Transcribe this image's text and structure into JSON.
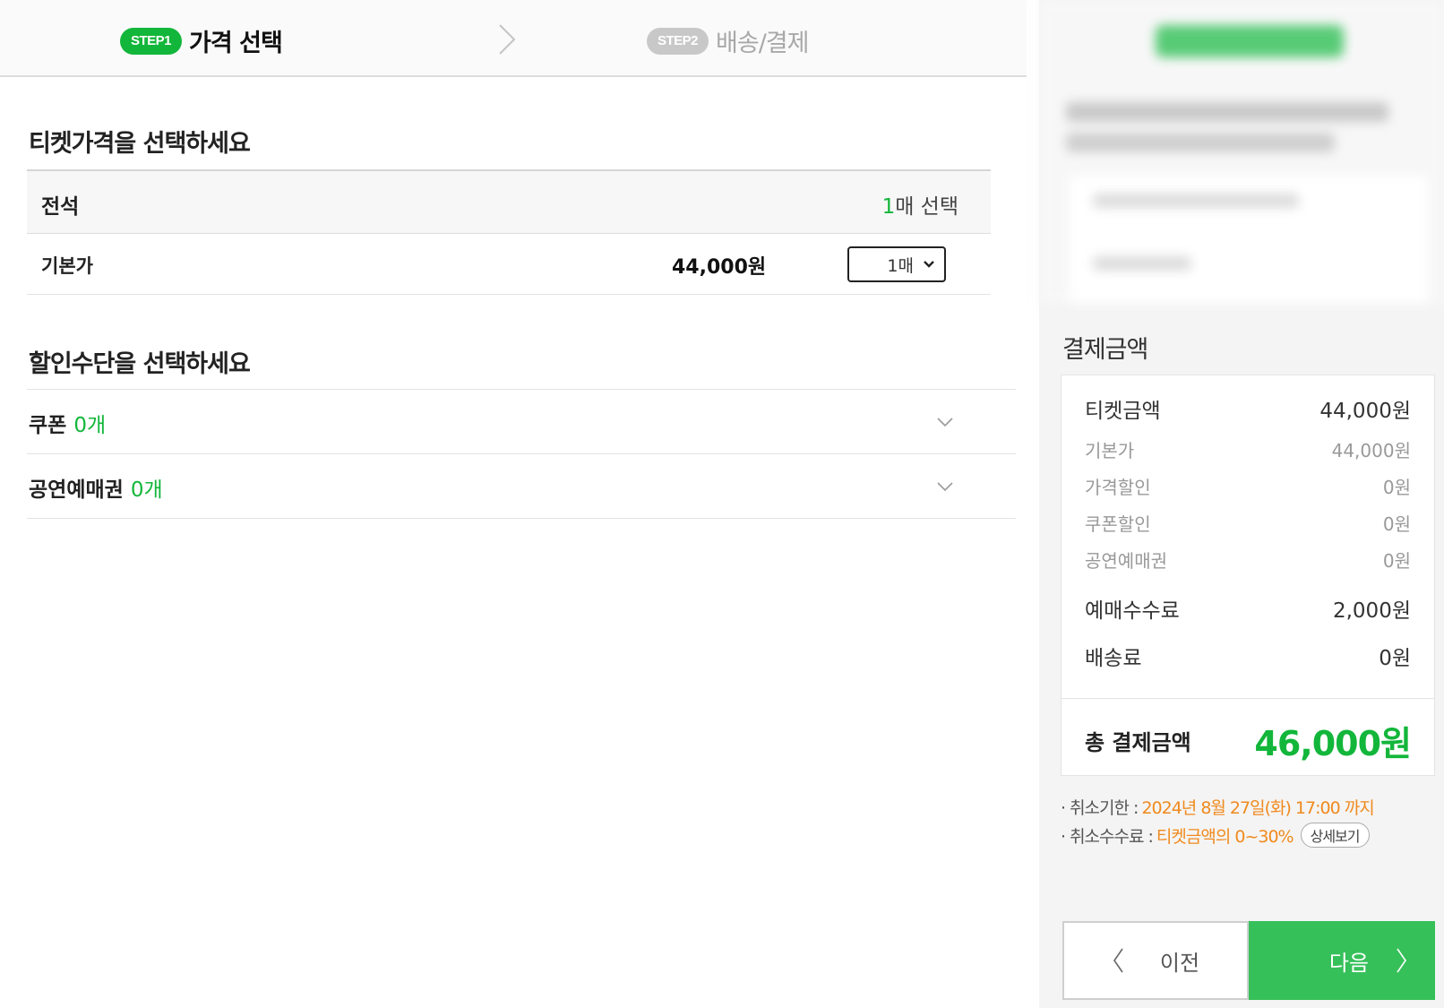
{
  "header": {
    "step1": {
      "badge": "STEP1",
      "label": "가격 선택"
    },
    "step2": {
      "badge": "STEP2",
      "label": "배송/결제"
    }
  },
  "price_section": {
    "title": "티켓가격을 선택하세요",
    "grade": {
      "name": "전석",
      "count_num": "1",
      "count_text": "매 선택"
    },
    "rows": [
      {
        "name": "기본가",
        "amount": "44,000원",
        "qty": "1매"
      }
    ]
  },
  "discount_section": {
    "title": "할인수단을 선택하세요",
    "items": [
      {
        "label": "쿠폰",
        "count": "0개"
      },
      {
        "label": "공연예매권",
        "count": "0개"
      }
    ]
  },
  "payment": {
    "title": "결제금액",
    "rows": {
      "ticket": {
        "label": "티켓금액",
        "value": "44,000원"
      },
      "base": {
        "label": "기본가",
        "value": "44,000원"
      },
      "price_dc": {
        "label": "가격할인",
        "value": "0원"
      },
      "coupon_dc": {
        "label": "쿠폰할인",
        "value": "0원"
      },
      "voucher": {
        "label": "공연예매권",
        "value": "0원"
      },
      "fee": {
        "label": "예매수수료",
        "value": "2,000원"
      },
      "shipping": {
        "label": "배송료",
        "value": "0원"
      }
    },
    "total": {
      "label": "총 결제금액",
      "value": "46,000원"
    }
  },
  "notes": {
    "cancel_deadline": {
      "label": "· 취소기한 :",
      "value": "2024년 8월 27일(화) 17:00 까지"
    },
    "cancel_fee": {
      "label": "· 취소수수료 :",
      "value": "티켓금액의 0~30%",
      "button": "상세보기"
    }
  },
  "buttons": {
    "prev": "이전",
    "next": "다음"
  },
  "colors": {
    "accent": "#12b63a",
    "warning": "#f08a1e",
    "next_button": "#36c05a"
  }
}
